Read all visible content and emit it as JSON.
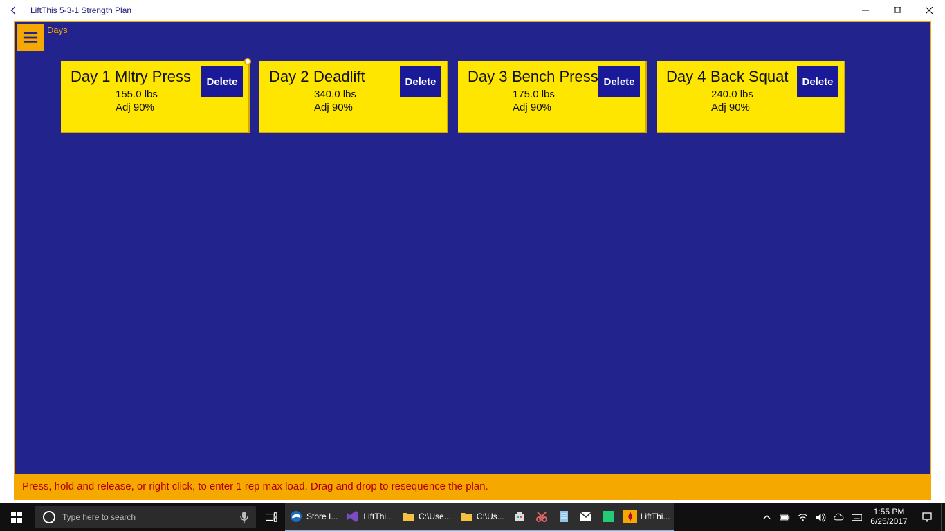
{
  "window": {
    "title": "LiftThis 5-3-1 Strength Plan"
  },
  "section_label": "Days",
  "cards": [
    {
      "day": "Day 1",
      "exercise": "Mltry Press",
      "weight": "155.0 lbs",
      "adj": "Adj  90%",
      "delete_label": "Delete",
      "has_circle": true
    },
    {
      "day": "Day 2",
      "exercise": "Deadlift",
      "weight": "340.0 lbs",
      "adj": "Adj  90%",
      "delete_label": "Delete",
      "has_circle": false
    },
    {
      "day": "Day 3",
      "exercise": "Bench Press",
      "weight": "175.0 lbs",
      "adj": "Adj  90%",
      "delete_label": "Delete",
      "has_circle": false
    },
    {
      "day": "Day 4",
      "exercise": "Back Squat",
      "weight": "240.0 lbs",
      "adj": "Adj  90%",
      "delete_label": "Delete",
      "has_circle": false
    }
  ],
  "hint": "Press, hold and release, or right click, to enter 1 rep max load.  Drag and drop to resequence the plan.",
  "taskbar": {
    "search_placeholder": "Type here to search",
    "items": [
      {
        "label": "Store I..."
      },
      {
        "label": "LiftThi..."
      },
      {
        "label": "C:\\Use..."
      },
      {
        "label": "C:\\Us..."
      },
      {
        "label": ""
      },
      {
        "label": ""
      },
      {
        "label": ""
      },
      {
        "label": ""
      },
      {
        "label": ""
      },
      {
        "label": "LiftThi..."
      }
    ],
    "time": "1:55 PM",
    "date": "6/25/2017"
  }
}
